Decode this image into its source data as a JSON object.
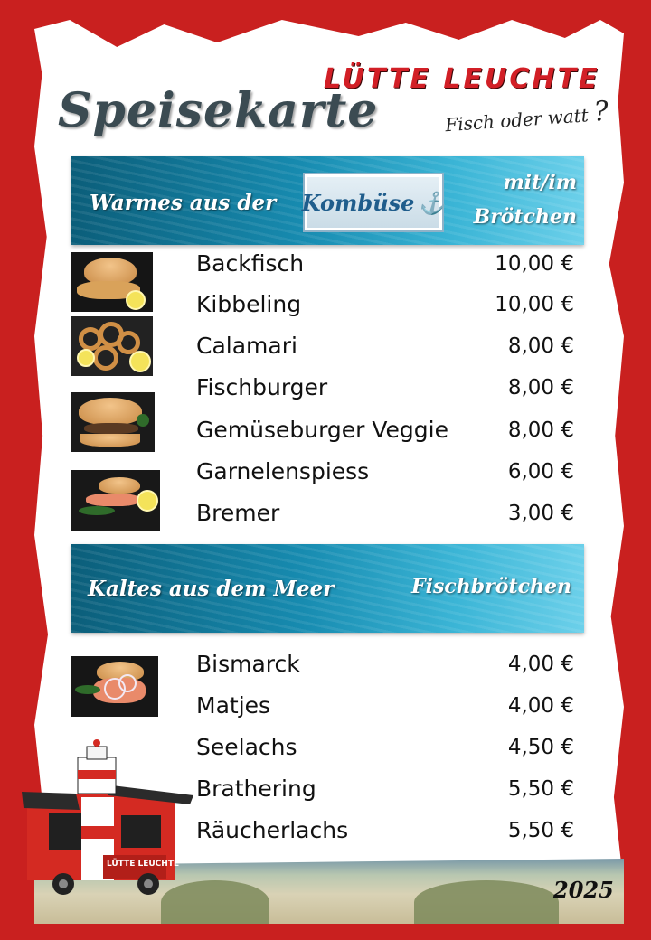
{
  "header": {
    "title": "Speisekarte",
    "brand": "LÜTTE LEUCHTE",
    "slogan": "Fisch oder watt",
    "slogan_mark": "?"
  },
  "section_warm": {
    "title": "Warmes aus der",
    "badge": "Kombüse",
    "badge_icon": "anchor-icon",
    "right_line1": "mit/im",
    "right_line2": "Brötchen",
    "items": [
      {
        "name": "Backfisch",
        "price": "10,00 €"
      },
      {
        "name": "Kibbeling",
        "price": "10,00 €"
      },
      {
        "name": "Calamari",
        "price": "8,00 €"
      },
      {
        "name": "Fischburger",
        "price": "8,00 €"
      },
      {
        "name": "Gemüseburger Veggie",
        "price": "8,00 €"
      },
      {
        "name": "Garnelenspiess",
        "price": "6,00 €"
      },
      {
        "name": "Bremer",
        "price": "3,00 €"
      }
    ]
  },
  "section_cold": {
    "title": "Kaltes aus dem Meer",
    "right": "Fischbrötchen",
    "items": [
      {
        "name": "Bismarck",
        "price": "4,00 €"
      },
      {
        "name": "Matjes",
        "price": "4,00 €"
      },
      {
        "name": "Seelachs",
        "price": "4,50 €"
      },
      {
        "name": "Brathering",
        "price": "5,50 €"
      },
      {
        "name": "Räucherlachs",
        "price": "5,50 €"
      }
    ]
  },
  "truck": {
    "label": "LÜTTE LEUCHTE"
  },
  "footer": {
    "year": "2025"
  },
  "colors": {
    "frame": "#c9201f",
    "brand": "#d21f26",
    "banner": "#178bb0"
  }
}
